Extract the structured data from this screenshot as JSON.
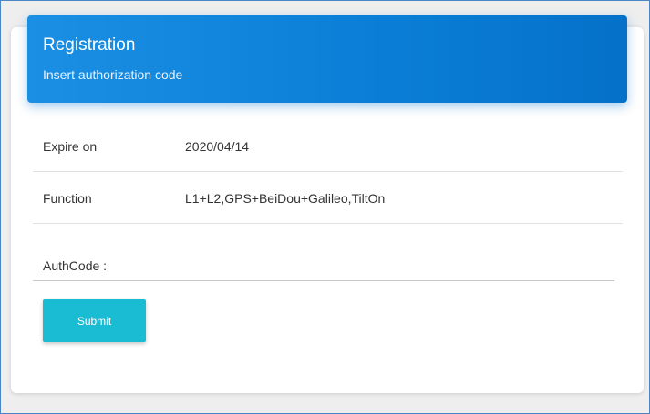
{
  "header": {
    "title": "Registration",
    "subtitle": "Insert authorization code"
  },
  "info": {
    "expire": {
      "label": "Expire on",
      "value": "2020/04/14"
    },
    "function": {
      "label": "Function",
      "value": "L1+L2,GPS+BeiDou+Galileo,TiltOn"
    }
  },
  "form": {
    "authcode_label": "AuthCode :",
    "authcode_value": "",
    "submit_label": "Submit"
  },
  "colors": {
    "header_blue": "#0a7ed6",
    "submit_teal": "#19bcd3"
  }
}
